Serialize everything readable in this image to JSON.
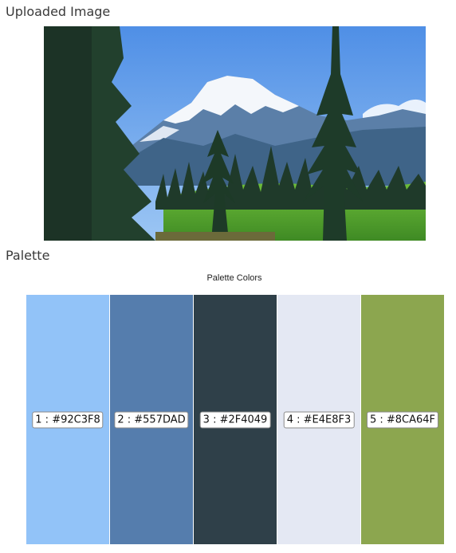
{
  "uploaded_heading": "Uploaded Image",
  "palette_heading": "Palette",
  "chart_data": {
    "type": "bar",
    "title": "Palette Colors",
    "categories": [
      "1 : #92C3F8",
      "2 : #557DAD",
      "3 : #2F4049",
      "4 : #E4E8F3",
      "5 : #8CA64F"
    ],
    "values": [
      1,
      1,
      1,
      1,
      1
    ],
    "colors": [
      "#92C3F8",
      "#557DAD",
      "#2F4049",
      "#E4E8F3",
      "#8CA64F"
    ]
  }
}
